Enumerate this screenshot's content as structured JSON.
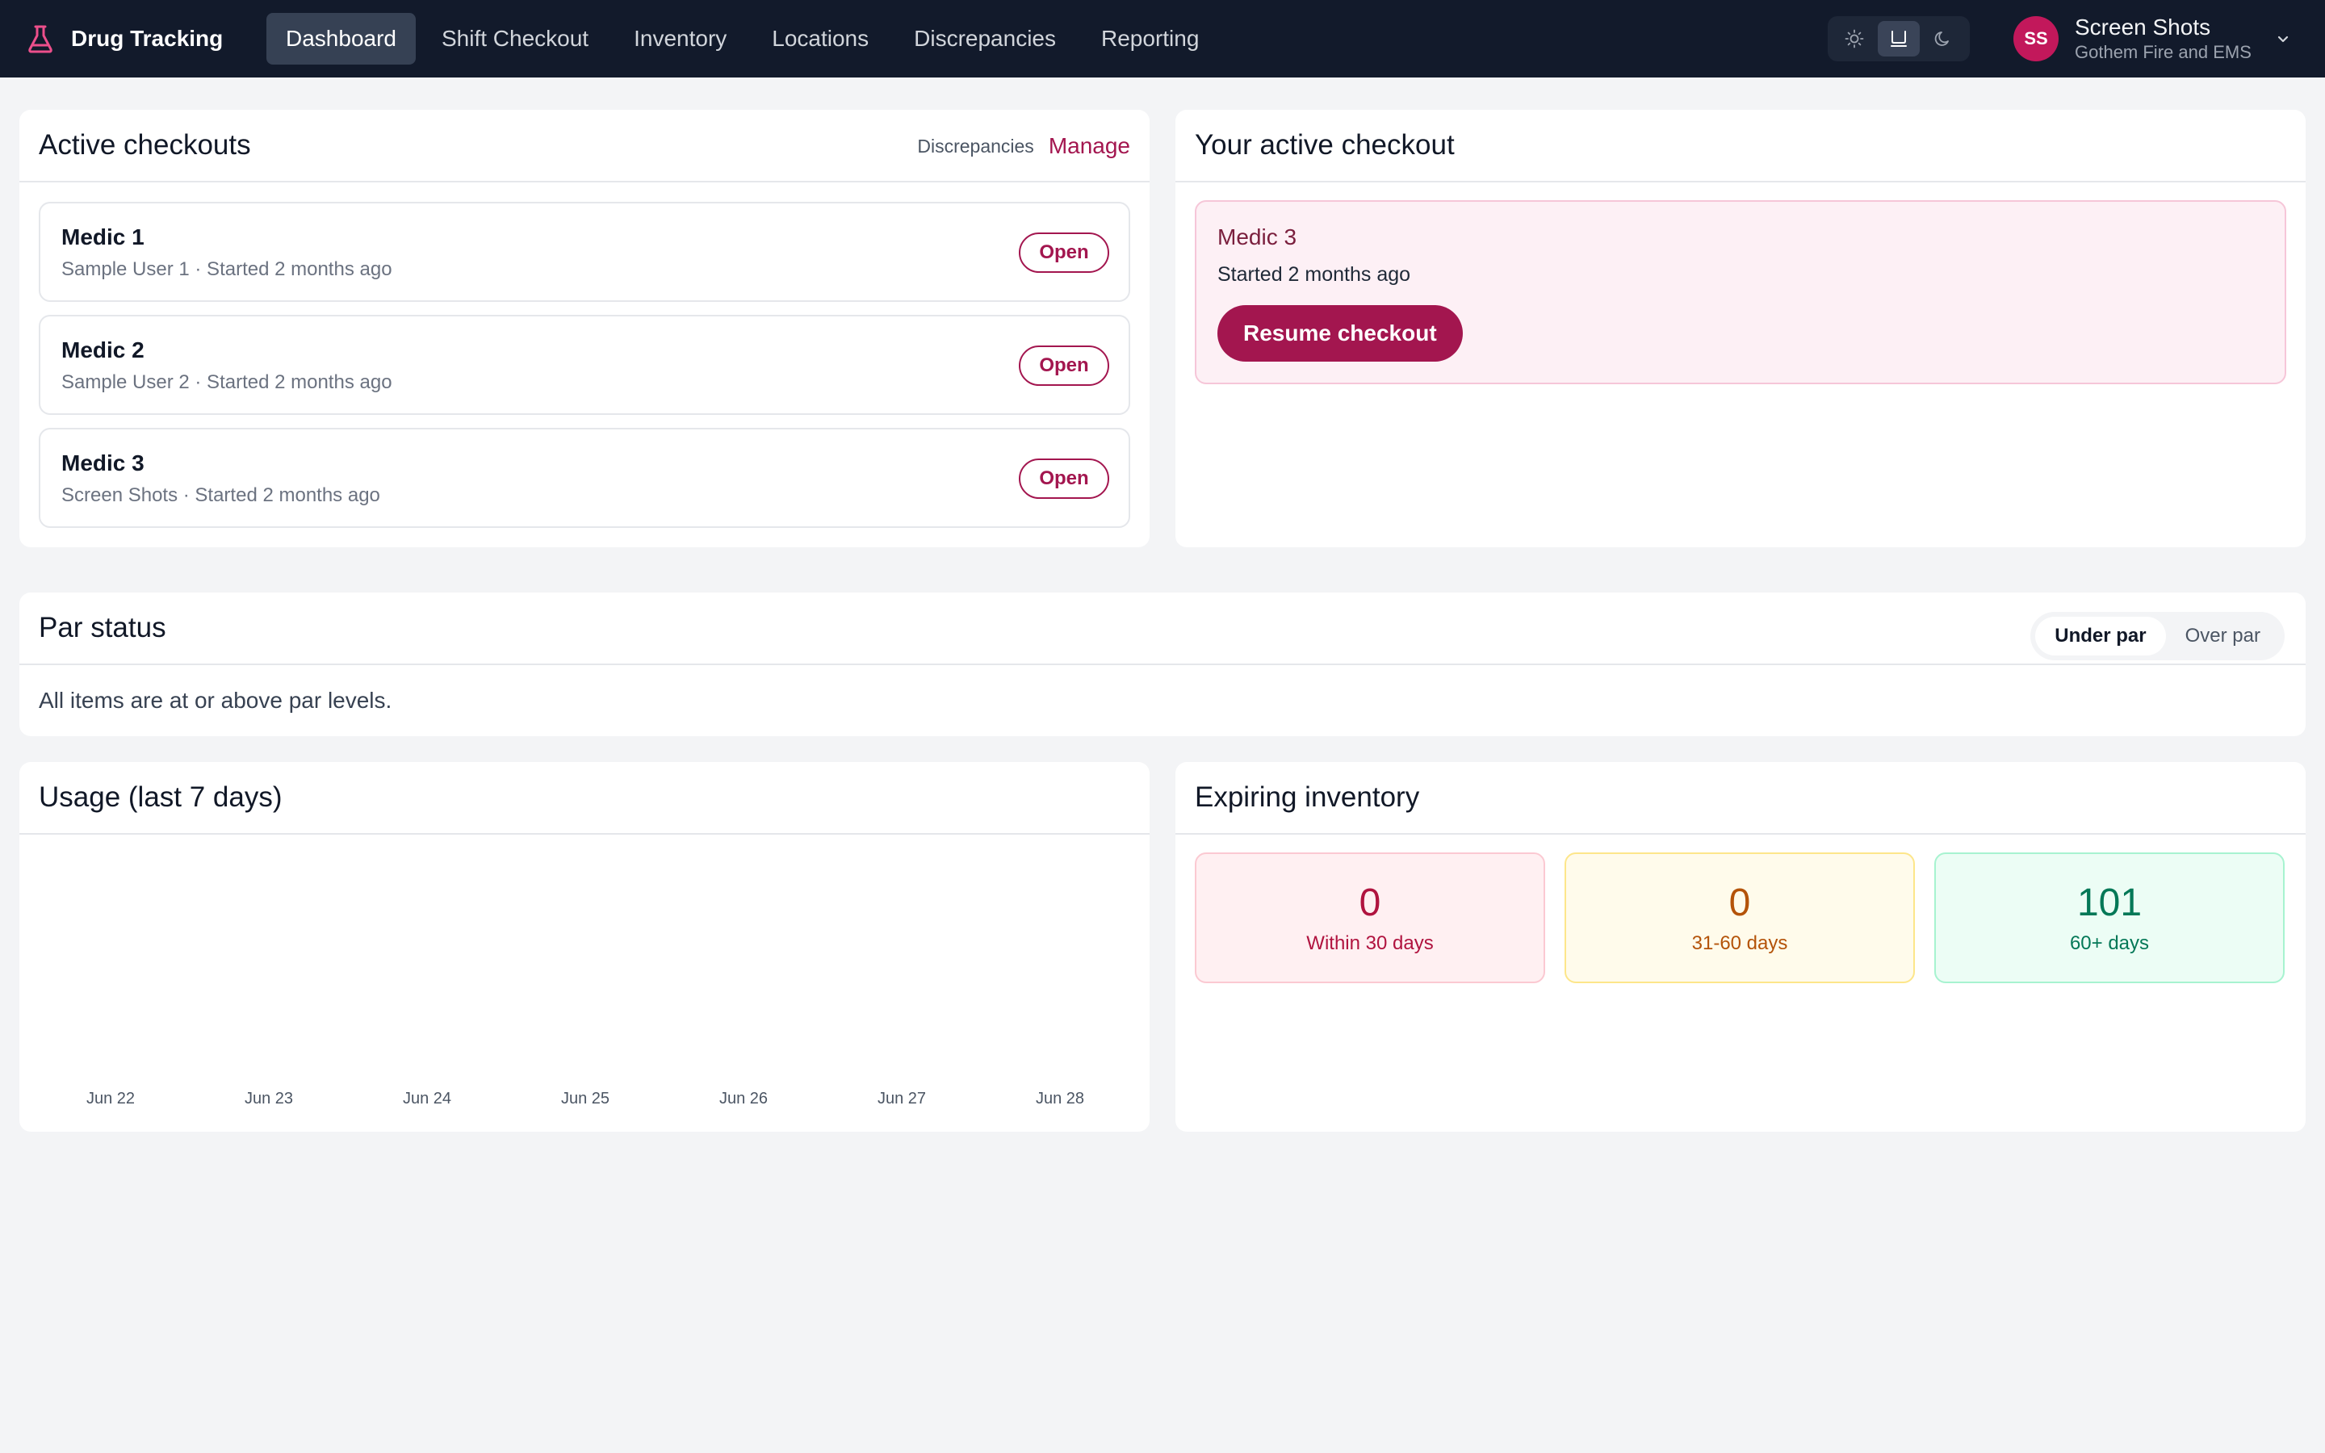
{
  "app": {
    "name": "Drug Tracking"
  },
  "nav": {
    "items": [
      {
        "label": "Dashboard",
        "active": true
      },
      {
        "label": "Shift Checkout"
      },
      {
        "label": "Inventory"
      },
      {
        "label": "Locations"
      },
      {
        "label": "Discrepancies"
      },
      {
        "label": "Reporting"
      }
    ]
  },
  "theme": {
    "options": [
      "sun-icon",
      "monitor-icon",
      "moon-icon"
    ],
    "selected": "monitor-icon"
  },
  "user": {
    "initials": "SS",
    "name": "Screen Shots",
    "org": "Gothem Fire and EMS"
  },
  "active_checkouts": {
    "title": "Active checkouts",
    "discrepancies_link": "Discrepancies",
    "manage_link": "Manage",
    "items": [
      {
        "name": "Medic 1",
        "sub": "Sample User 1 · Started 2 months ago",
        "button": "Open"
      },
      {
        "name": "Medic 2",
        "sub": "Sample User 2 · Started 2 months ago",
        "button": "Open"
      },
      {
        "name": "Medic 3",
        "sub": "Screen Shots · Started 2 months ago",
        "button": "Open"
      }
    ]
  },
  "your_checkout": {
    "title": "Your active checkout",
    "name": "Medic 3",
    "started": "Started 2 months ago",
    "button": "Resume checkout"
  },
  "par_status": {
    "title": "Par status",
    "options": [
      "Under par",
      "Over par"
    ],
    "selected": "Under par",
    "message": "All items are at or above par levels."
  },
  "usage": {
    "title": "Usage (last 7 days)"
  },
  "chart_data": {
    "type": "bar",
    "title": "Usage (last 7 days)",
    "categories": [
      "Jun 22",
      "Jun 23",
      "Jun 24",
      "Jun 25",
      "Jun 26",
      "Jun 27",
      "Jun 28"
    ],
    "values": [
      0,
      0,
      0,
      0,
      0,
      0,
      0
    ],
    "xlabel": "",
    "ylabel": "",
    "grid": false
  },
  "expiring": {
    "title": "Expiring inventory",
    "boxes": [
      {
        "count": "0",
        "label": "Within 30 days",
        "color": "#b0133f",
        "bg": "#fff0f2",
        "border": "#fbc9d2"
      },
      {
        "count": "0",
        "label": "31-60 days",
        "color": "#b45309",
        "bg": "#fffbeb",
        "border": "#fde68a"
      },
      {
        "count": "101",
        "label": "60+ days",
        "color": "#047857",
        "bg": "#ecfdf5",
        "border": "#a7f3d0"
      }
    ]
  },
  "colors": {
    "accent": "#a3164f",
    "nav_bg": "#121a2b",
    "page_bg": "#f3f4f6"
  }
}
